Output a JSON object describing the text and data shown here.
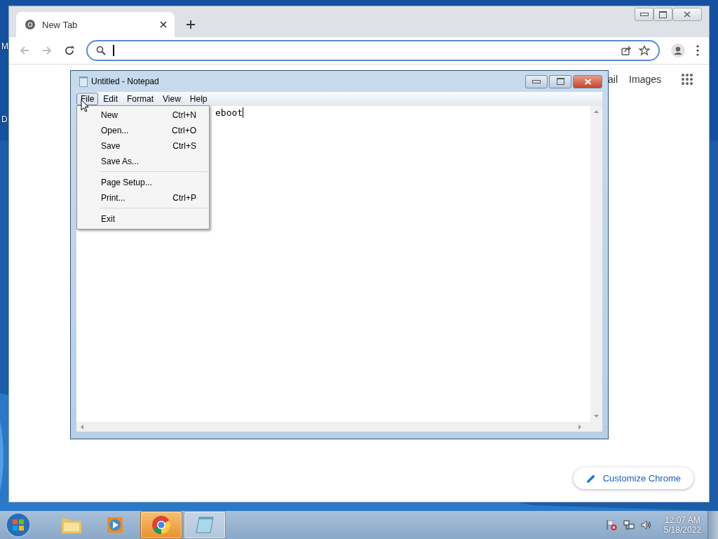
{
  "desktop": {
    "icon_labels": [
      "M",
      "D"
    ]
  },
  "browser": {
    "tabs": [
      {
        "label": "New Tab",
        "selected": true
      }
    ],
    "address": {
      "focused": true
    },
    "header_links": [
      "ail",
      "Images"
    ],
    "customize_button": "Customize Chrome"
  },
  "notepad": {
    "title": "Untitled - Notepad",
    "menu": [
      {
        "label": "File",
        "selected": true
      },
      {
        "label": "Edit",
        "selected": false
      },
      {
        "label": "Format",
        "selected": false
      },
      {
        "label": "View",
        "selected": false
      },
      {
        "label": "Help",
        "selected": false
      }
    ],
    "text": "eboot",
    "file_menu": [
      {
        "kind": "item",
        "label": "New",
        "shortcut": "Ctrl+N"
      },
      {
        "kind": "item",
        "label": "Open...",
        "shortcut": "Ctrl+O"
      },
      {
        "kind": "item",
        "label": "Save",
        "shortcut": "Ctrl+S"
      },
      {
        "kind": "item",
        "label": "Save As..."
      },
      {
        "kind": "separator"
      },
      {
        "kind": "item",
        "label": "Page Setup..."
      },
      {
        "kind": "item",
        "label": "Print...",
        "shortcut": "Ctrl+P"
      },
      {
        "kind": "separator"
      },
      {
        "kind": "item",
        "label": "Exit"
      }
    ]
  },
  "taskbar": {
    "apps": [
      {
        "kind": "folder",
        "selected": false,
        "open": false
      },
      {
        "kind": "media",
        "selected": false,
        "open": false
      },
      {
        "kind": "chrome",
        "selected": true,
        "open": true
      },
      {
        "kind": "notepad",
        "selected": false,
        "open": true
      }
    ],
    "time": "12:07 AM",
    "date": "5/18/2022"
  }
}
